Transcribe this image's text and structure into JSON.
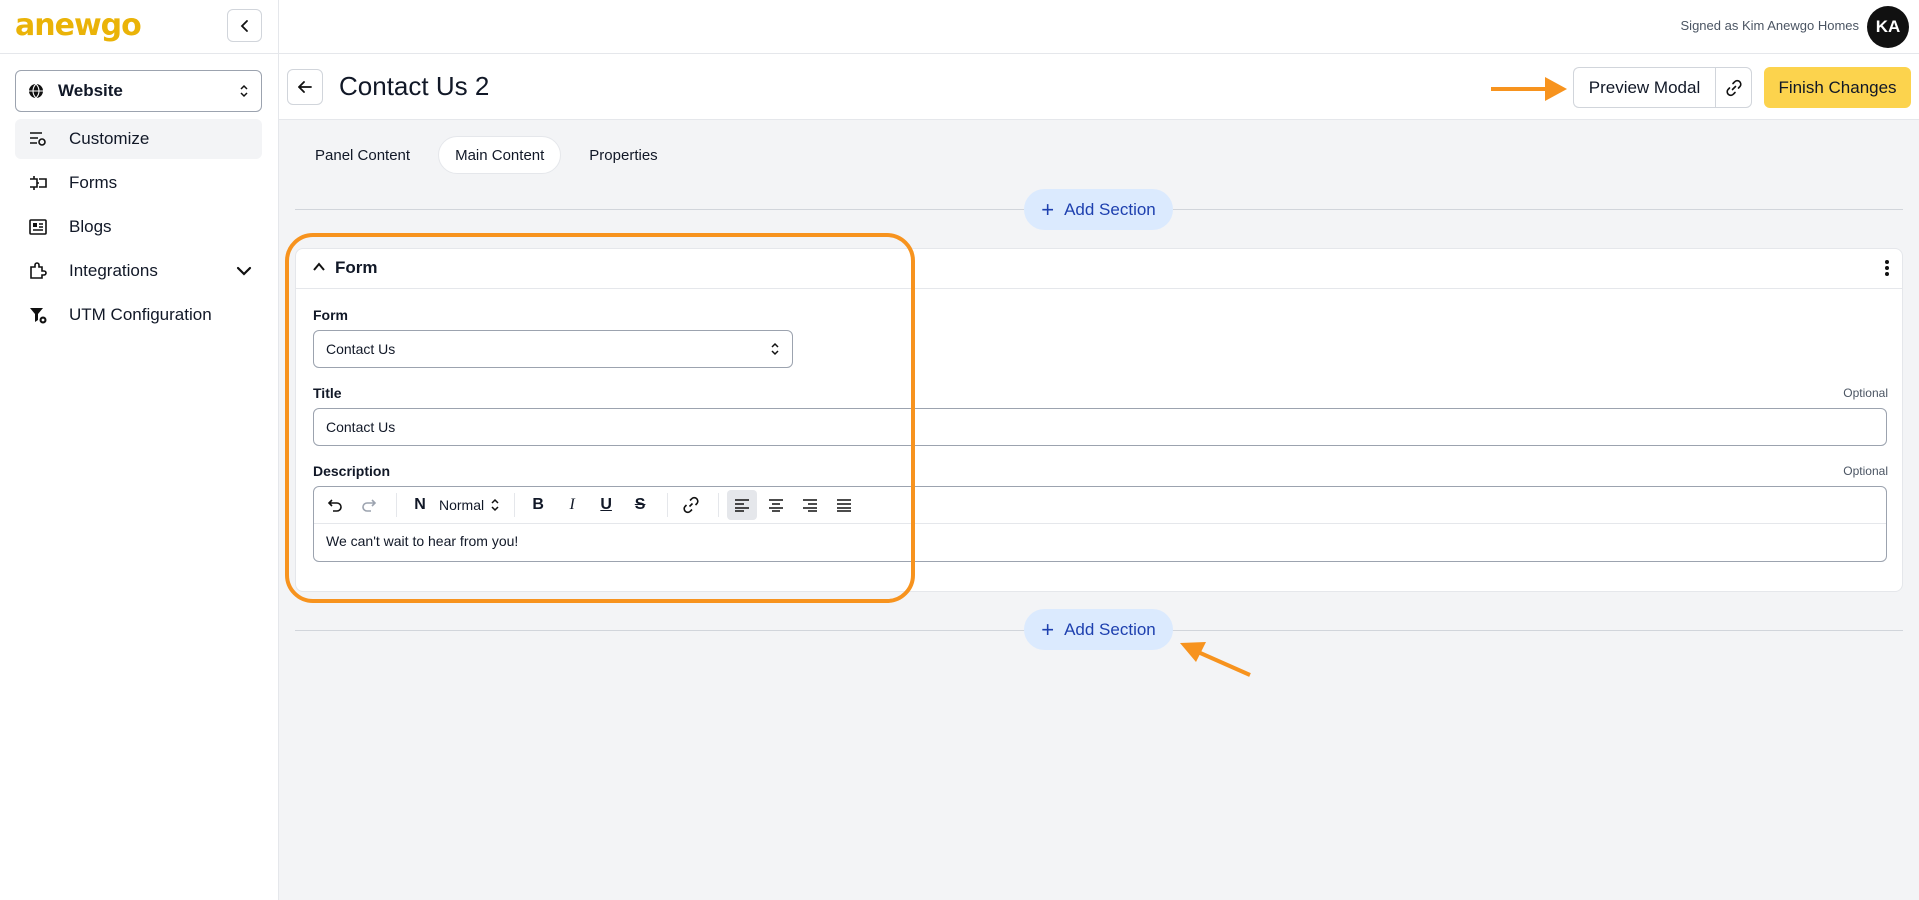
{
  "brand": {
    "logo_text": "anewgo",
    "accent_color": "#facc15",
    "annotation_color": "#f7931e"
  },
  "sidebar": {
    "site_select": {
      "value": "Website",
      "icon": "globe-icon"
    },
    "items": [
      {
        "label": "Customize",
        "icon": "customize-icon",
        "active": true
      },
      {
        "label": "Forms",
        "icon": "forms-icon"
      },
      {
        "label": "Blogs",
        "icon": "blogs-icon"
      },
      {
        "label": "Integrations",
        "icon": "integrations-icon",
        "has_caret": true
      },
      {
        "label": "UTM Configuration",
        "icon": "utm-icon"
      }
    ]
  },
  "header": {
    "signed_as": "Signed as Kim Anewgo Homes",
    "avatar_initials": "KA"
  },
  "page": {
    "title": "Contact Us 2",
    "preview_label": "Preview Modal",
    "finish_label": "Finish Changes"
  },
  "tabs": [
    {
      "label": "Panel Content"
    },
    {
      "label": "Main Content",
      "active": true
    },
    {
      "label": "Properties"
    }
  ],
  "add_section_label": "Add Section",
  "section": {
    "title": "Form",
    "form_field": {
      "label": "Form",
      "value": "Contact Us"
    },
    "title_field": {
      "label": "Title",
      "optional": "Optional",
      "value": "Contact Us"
    },
    "description_field": {
      "label": "Description",
      "optional": "Optional",
      "format": "Normal",
      "value": "We can't wait to hear from you!"
    }
  }
}
